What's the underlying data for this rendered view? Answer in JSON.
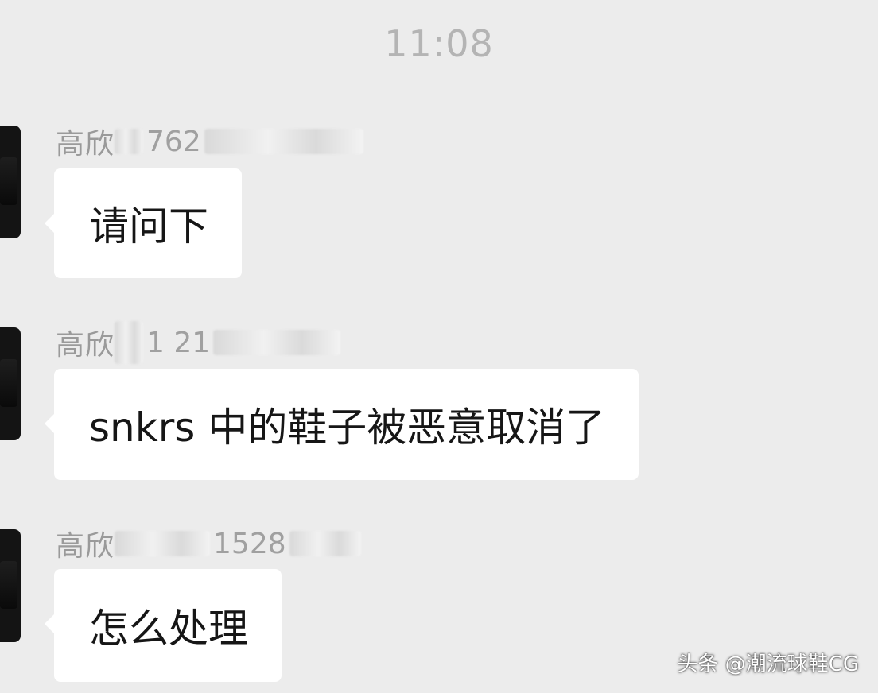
{
  "chat": {
    "timestamp": "11:08",
    "messages": [
      {
        "sender_name": "高欣",
        "sender_visible_digits": "762",
        "text": "请问下"
      },
      {
        "sender_name": "高欣",
        "sender_visible_digits": "1 21",
        "text": "snkrs 中的鞋子被恶意取消了"
      },
      {
        "sender_name": "高欣",
        "sender_visible_digits": "1528",
        "text": "怎么处理"
      }
    ]
  },
  "watermark": {
    "text": "头条 @潮流球鞋CG"
  },
  "colors": {
    "background": "#ececec",
    "bubble": "#ffffff",
    "timestamp": "#b4b4b4",
    "sender": "#9a9a9a",
    "avatar": "#141414"
  }
}
